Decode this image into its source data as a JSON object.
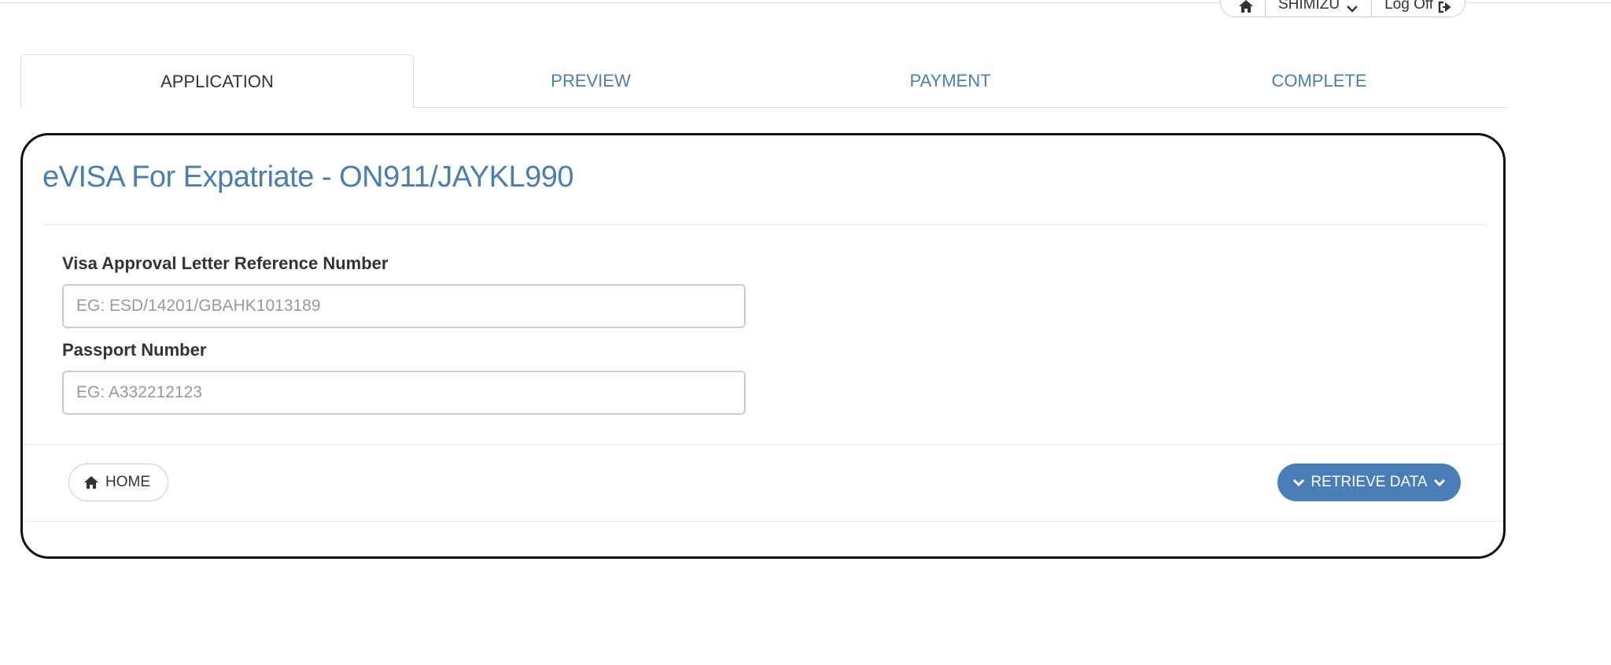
{
  "topbar": {
    "home_icon": "home-icon",
    "user_name": "SHIMIZU",
    "user_dropdown_icon": "chevron-down-icon",
    "logoff_label": "Log Off",
    "logoff_icon": "sign-out-icon"
  },
  "tabs": [
    {
      "label": "APPLICATION",
      "active": true
    },
    {
      "label": "PREVIEW",
      "active": false
    },
    {
      "label": "PAYMENT",
      "active": false
    },
    {
      "label": "COMPLETE",
      "active": false
    }
  ],
  "panel": {
    "title": "eVISA For Expatriate - ON911/JAYKL990",
    "fields": [
      {
        "label": "Visa Approval Letter Reference Number",
        "value": "",
        "placeholder": "EG: ESD/14201/GBAHK1013189"
      },
      {
        "label": "Passport Number",
        "value": "",
        "placeholder": "EG: A332212123"
      }
    ],
    "home_button": {
      "label": "HOME",
      "icon": "home-icon"
    },
    "retrieve_button": {
      "label": "RETRIEVE DATA",
      "icon": "chevron-down-icon"
    }
  },
  "colors": {
    "link_blue": "#4a7eaf",
    "button_blue": "#4a7eb8",
    "panel_border": "#111111"
  }
}
